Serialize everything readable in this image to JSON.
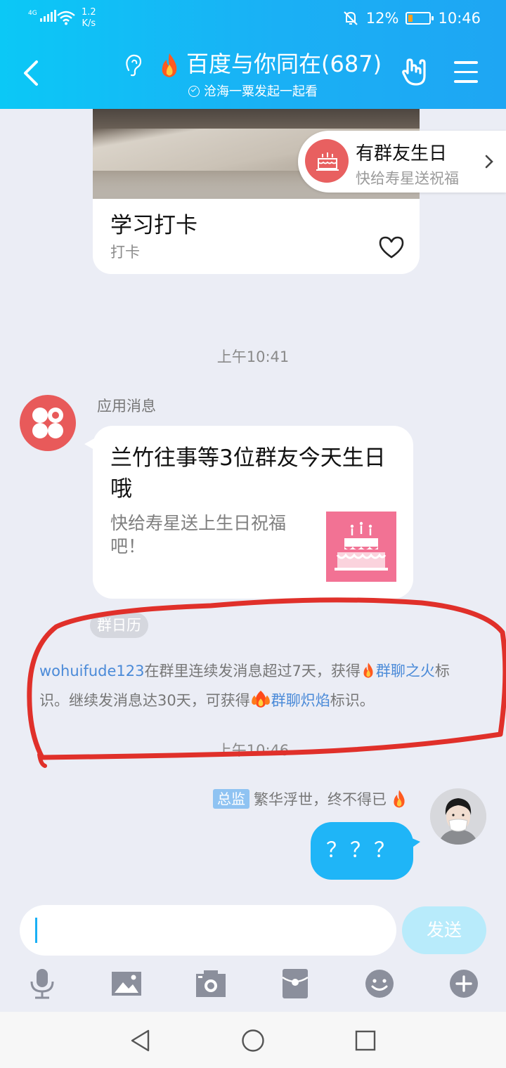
{
  "status": {
    "network": "4G",
    "speed_value": "1.2",
    "speed_unit": "K/s",
    "battery": "12%",
    "time": "10:46"
  },
  "header": {
    "title": "百度与你同在(687)",
    "subtitle": "沧海一粟发起一起看"
  },
  "chat": {
    "card": {
      "title": "学习打卡",
      "subtitle": "打卡"
    },
    "birthday_chip": {
      "title": "有群友生日",
      "subtitle": "快给寿星送祝福"
    },
    "time_1": "上午10:41",
    "app_message": {
      "sender": "应用消息",
      "title": "兰竹往事等3位群友今天生日哦",
      "desc": "快给寿星送上生日祝福吧！"
    },
    "calendar_chip": "群日历",
    "notice": {
      "user": "wohuifude123",
      "p1": "在群里连续发消息超过7天，获得",
      "link1": "群聊之火",
      "p2": "标识。继续发消息达30天，可获得",
      "link2": "群聊炽焰",
      "p3": "标识。"
    },
    "time_2": "上午10:46",
    "my_message": {
      "badge": "总监",
      "name": "繁华浮世，终不得已",
      "text": "？？？"
    }
  },
  "input": {
    "send_label": "发送"
  },
  "colors": {
    "header": "#1ab0f5",
    "bubble_self": "#1fb5f7",
    "link": "#4a8ad8",
    "annotation": "#e0302a"
  }
}
